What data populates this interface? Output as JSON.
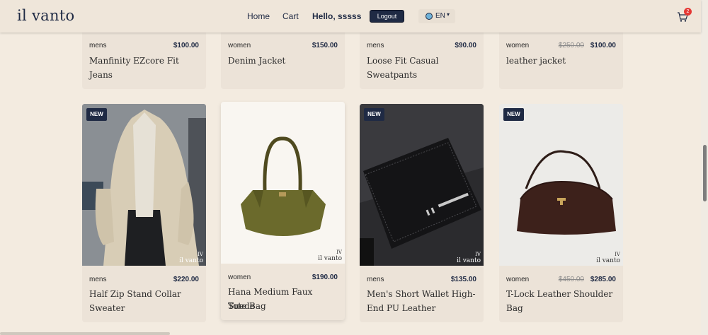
{
  "navbar": {
    "brand": "il vanto",
    "home": "Home",
    "cart": "Cart",
    "hello": "Hello, sssss",
    "logout": "Logout",
    "lang_code": "EN",
    "lang_caret": "▾",
    "cart_count": "2"
  },
  "products_top": [
    {
      "category": "mens",
      "price": "$100.00",
      "old_price": "",
      "name_line1": "Manfinity EZcore Fit Jeans",
      "name_line2": ""
    },
    {
      "category": "women",
      "price": "$150.00",
      "old_price": "",
      "name_line1": "Denim Jacket",
      "name_line2": ""
    },
    {
      "category": "mens",
      "price": "$90.00",
      "old_price": "",
      "name_line1": "Loose Fit Casual",
      "name_line2": "Sweatpants"
    },
    {
      "category": "women",
      "price": "$100.00",
      "old_price": "$250.00",
      "name_line1": "leather jacket",
      "name_line2": ""
    }
  ],
  "products_bottom": [
    {
      "badge": "NEW",
      "category": "mens",
      "price": "$220.00",
      "old_price": "",
      "name_line1": "Half Zip Stand Collar",
      "name_line2": "Sweater",
      "wm_a": "IV",
      "wm_b": "il vanto"
    },
    {
      "badge": "",
      "category": "women",
      "price": "$190.00",
      "old_price": "",
      "name_line1": "Hana Medium Faux Suede",
      "name_line2": "Tote Bag",
      "wm_a": "IV",
      "wm_b": "il vanto"
    },
    {
      "badge": "NEW",
      "category": "mens",
      "price": "$135.00",
      "old_price": "",
      "name_line1": "Men's Short Wallet High-",
      "name_line2": "End PU Leather",
      "wm_a": "IV",
      "wm_b": "il vanto"
    },
    {
      "badge": "NEW",
      "category": "women",
      "price": "$285.00",
      "old_price": "$450.00",
      "name_line1": "T-Lock Leather Shoulder",
      "name_line2": "Bag",
      "wm_a": "IV",
      "wm_b": "il vanto"
    }
  ],
  "colors": {
    "navy": "#1f2a44",
    "background": "#f3ebe0",
    "card": "#ece3d8",
    "badge_red": "#e53935"
  }
}
